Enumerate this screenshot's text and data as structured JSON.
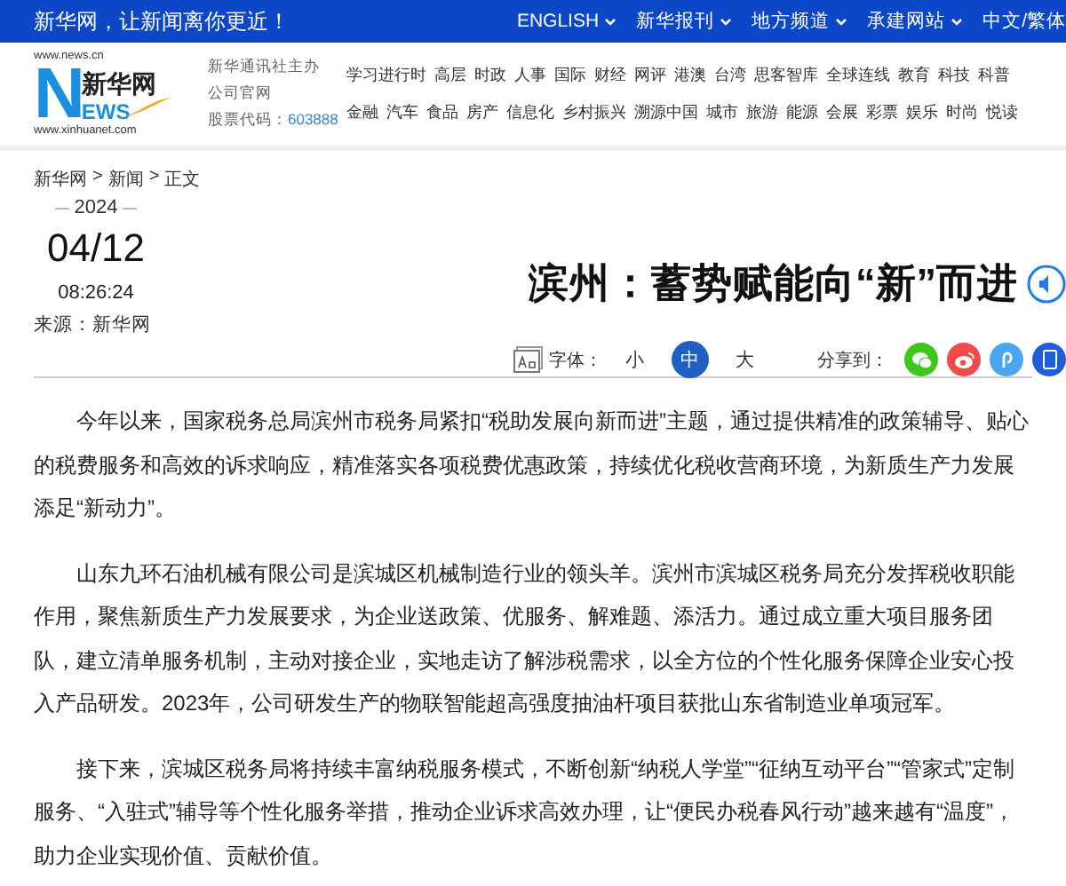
{
  "top_bar": {
    "slogan": "新华网，让新闻离你更近！",
    "links": [
      {
        "label": "ENGLISH",
        "dropdown": true
      },
      {
        "label": "新华报刊",
        "dropdown": true
      },
      {
        "label": "地方频道",
        "dropdown": true
      },
      {
        "label": "承建网站",
        "dropdown": true
      },
      {
        "label": "中文/繁体",
        "dropdown": false
      }
    ]
  },
  "logo": {
    "url_top": "www.news.cn",
    "letter": "N",
    "name": "新华网",
    "letters": "EWS",
    "url_bottom": "www.xinhuanet.com"
  },
  "org": {
    "line1": "新华通讯社主办",
    "line2": "公司官网",
    "stock_label": "股票代码：",
    "stock_code": "603888"
  },
  "nav_rows": [
    [
      "学习进行时",
      "高层",
      "时政",
      "人事",
      "国际",
      "财经",
      "网评",
      "港澳",
      "台湾",
      "思客智库",
      "全球连线",
      "教育",
      "科技",
      "科普"
    ],
    [
      "金融",
      "汽车",
      "食品",
      "房产",
      "信息化",
      "乡村振兴",
      "溯源中国",
      "城市",
      "旅游",
      "能源",
      "会展",
      "彩票",
      "娱乐",
      "时尚",
      "悦读"
    ]
  ],
  "breadcrumb": [
    {
      "label": "新华网"
    },
    {
      "separator": ">",
      "label": "新闻"
    },
    {
      "separator": ">",
      "label": "正文"
    }
  ],
  "date": {
    "year": "2024",
    "day": "04/12",
    "time": "08:26:24",
    "source": "来源：新华网"
  },
  "title": "滨州：蓄势赋能向“新”而进",
  "font_size": {
    "label": "字体：",
    "options": [
      {
        "label": "小",
        "selected": false
      },
      {
        "label": "中",
        "selected": true
      },
      {
        "label": "大",
        "selected": false
      }
    ]
  },
  "share": {
    "label": "分享到：",
    "targets": [
      {
        "kind": "wechat",
        "color": "#3fc51c"
      },
      {
        "kind": "weibo",
        "color": "#f04a4a"
      },
      {
        "kind": "link",
        "color": "#4aa6f0"
      },
      {
        "kind": "phone",
        "color": "#1e5fd8"
      }
    ]
  },
  "paragraphs": [
    "今年以来，国家税务总局滨州市税务局紧扣“税助发展向新而进”主题，通过提供精准的政策辅导、贴心的税费服务和高效的诉求响应，精准落实各项税费优惠政策，持续优化税收营商环境，为新质生产力发展添足“新动力”。",
    "山东九环石油机械有限公司是滨城区机械制造行业的领头羊。滨州市滨城区税务局充分发挥税收职能作用，聚焦新质生产力发展要求，为企业送政策、优服务、解难题、添活力。通过成立重大项目服务团队，建立清单服务机制，主动对接企业，实地走访了解涉税需求，以全方位的个性化服务保障企业安心投入产品研发。2023年，公司研发生产的物联智能超高强度抽油杆项目获批山东省制造业单项冠军。",
    "接下来，滨城区税务局将持续丰富纳税服务模式，不断创新“纳税人学堂”“征纳互动平台”“管家式”定制服务、“入驻式”辅导等个性化服务举措，推动企业诉求高效办理，让“便民办税春风行动”越来越有“温度”，助力企业实现价值、贡献价值。"
  ]
}
